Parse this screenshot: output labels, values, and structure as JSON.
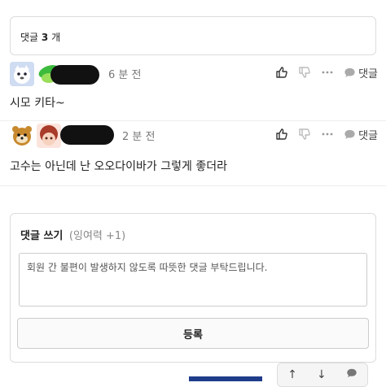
{
  "header": {
    "prefix": "댓글",
    "count": "3",
    "suffix": "개"
  },
  "comments": [
    {
      "time": "6 분 전",
      "text": "시모 키타~",
      "reply_label": "댓글"
    },
    {
      "time": "2 분 전",
      "text": "고수는 아닌데 난 오오다이바가 그렇게 좋더라",
      "reply_label": "댓글"
    }
  ],
  "write": {
    "title": "댓글 쓰기",
    "sub": "(잉여력 +1)",
    "placeholder": "회원 간 불편이 발생하지 않도록 따뜻한 댓글 부탁드립니다.",
    "submit_label": "등록"
  },
  "icons": {
    "like": "thumbs-up-icon",
    "dislike": "thumbs-down-icon",
    "more": "more-icon",
    "reply": "speech-bubble-icon"
  }
}
